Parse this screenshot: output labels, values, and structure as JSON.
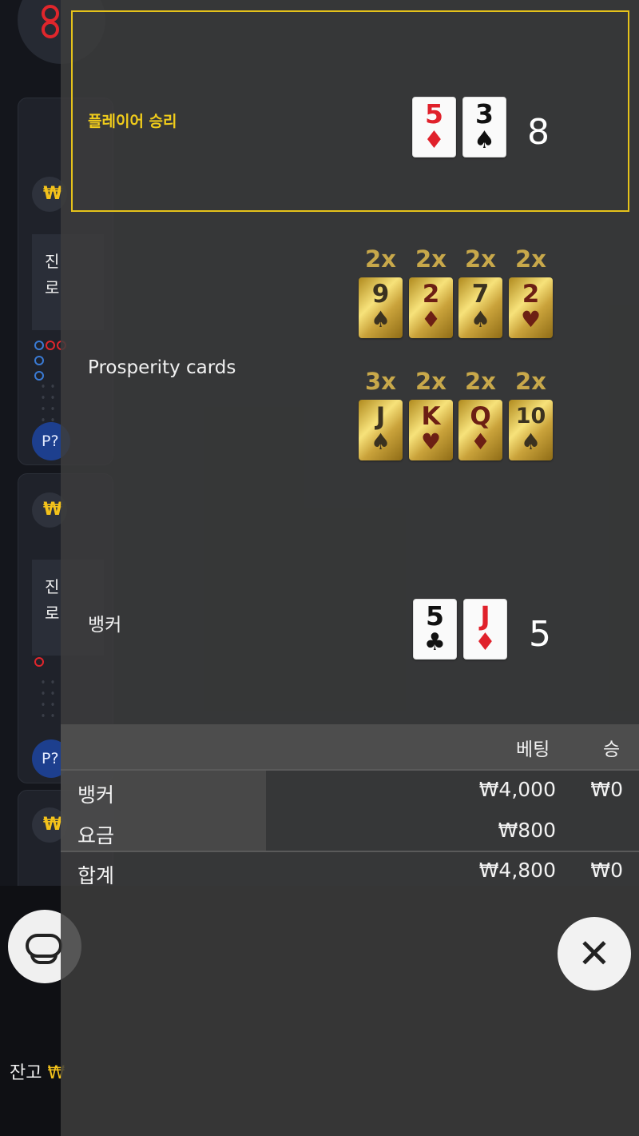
{
  "result": {
    "winner_label": "플레이어 승리",
    "player_cards": [
      {
        "rank": "5",
        "suit": "♦",
        "color": "red"
      },
      {
        "rank": "3",
        "suit": "♠",
        "color": "black"
      }
    ],
    "player_score": "8",
    "prosperity_label": "Prosperity cards",
    "prosperity_cards": [
      {
        "mult": "2x",
        "rank": "9",
        "suit": "♠",
        "tone": "dark"
      },
      {
        "mult": "2x",
        "rank": "2",
        "suit": "♦",
        "tone": "maroon"
      },
      {
        "mult": "2x",
        "rank": "7",
        "suit": "♠",
        "tone": "dark"
      },
      {
        "mult": "2x",
        "rank": "2",
        "suit": "♥",
        "tone": "maroon"
      },
      {
        "mult": "3x",
        "rank": "J",
        "suit": "♠",
        "tone": "dark"
      },
      {
        "mult": "2x",
        "rank": "K",
        "suit": "♥",
        "tone": "maroon"
      },
      {
        "mult": "2x",
        "rank": "Q",
        "suit": "♦",
        "tone": "maroon"
      },
      {
        "mult": "2x",
        "rank": "10",
        "suit": "♠",
        "tone": "dark"
      }
    ],
    "banker_label": "뱅커",
    "banker_cards": [
      {
        "rank": "5",
        "suit": "♣",
        "color": "black"
      },
      {
        "rank": "J",
        "suit": "♦",
        "color": "red"
      }
    ],
    "banker_score": "5"
  },
  "bets": {
    "headers": {
      "bet": "베팅",
      "win": "승"
    },
    "rows": [
      {
        "label": "뱅커",
        "bet": "₩4,000",
        "win": "₩0"
      },
      {
        "label": "요금",
        "bet": "₩800",
        "win": ""
      },
      {
        "label": "합계",
        "bet": "₩4,800",
        "win": "₩0"
      }
    ]
  },
  "background": {
    "currency_symbol": "₩",
    "msg_line1": "진",
    "msg_line2": "로",
    "player_badge": "P?",
    "balance_label": "잔고",
    "balance_currency": "₩"
  },
  "colors": {
    "accent": "#e5c21a",
    "winner_text": "#f0cc1b",
    "card_red": "#e0212b"
  },
  "icons": {
    "close": "close-icon",
    "table": "table-icon"
  }
}
